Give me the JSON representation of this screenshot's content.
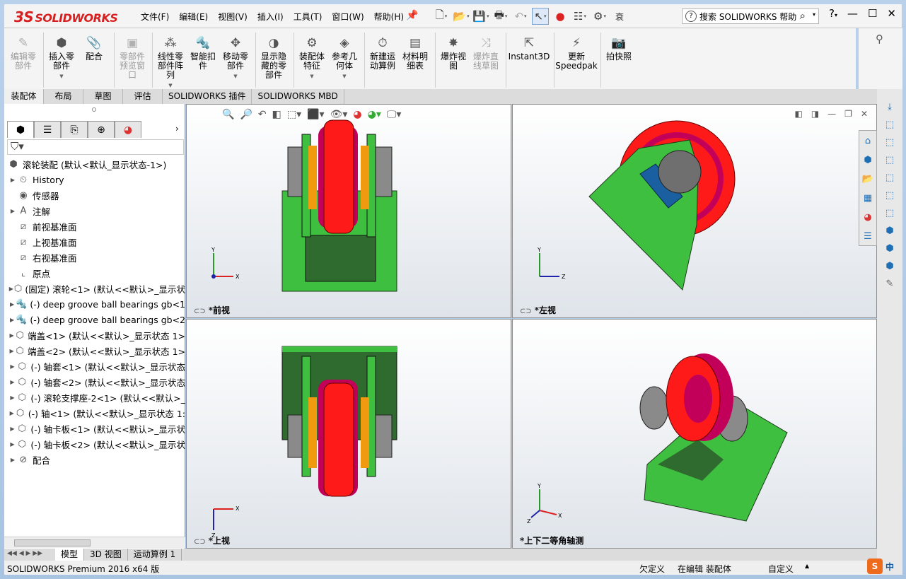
{
  "app": {
    "logo": "SOLIDWORKS",
    "logo_mark": "3S",
    "status_product": "SOLIDWORKS Premium 2016 x64 版"
  },
  "menu": [
    "文件(F)",
    "编辑(E)",
    "视图(V)",
    "插入(I)",
    "工具(T)",
    "窗口(W)",
    "帮助(H)"
  ],
  "quick_more": "衰",
  "search": {
    "placeholder": "搜索 SOLIDWORKS 帮助"
  },
  "ribbon": [
    {
      "label": "编辑零\n部件",
      "enabled": false,
      "icon": "edit-component-icon"
    },
    {
      "label": "插入零\n部件",
      "enabled": true,
      "icon": "insert-components-icon",
      "dropdown": true
    },
    {
      "label": "配合",
      "enabled": true,
      "icon": "mate-icon"
    },
    {
      "label": "零部件\n预览窗\n口",
      "enabled": false,
      "icon": "component-preview-icon"
    },
    {
      "label": "线性零\n部件阵\n列",
      "enabled": true,
      "icon": "linear-pattern-icon",
      "dropdown": true
    },
    {
      "label": "智能扣\n件",
      "enabled": true,
      "icon": "smart-fasteners-icon"
    },
    {
      "label": "移动零\n部件",
      "enabled": true,
      "icon": "move-component-icon",
      "dropdown": true
    },
    {
      "label": "显示隐\n藏的零\n部件",
      "enabled": true,
      "icon": "show-hidden-icon"
    },
    {
      "label": "装配体\n特征",
      "enabled": true,
      "icon": "assembly-features-icon",
      "dropdown": true
    },
    {
      "label": "参考几\n何体",
      "enabled": true,
      "icon": "reference-geometry-icon",
      "dropdown": true
    },
    {
      "label": "新建运\n动算例",
      "enabled": true,
      "icon": "new-motion-study-icon"
    },
    {
      "label": "材料明\n细表",
      "enabled": true,
      "icon": "bom-icon"
    },
    {
      "label": "爆炸视\n图",
      "enabled": true,
      "icon": "exploded-view-icon"
    },
    {
      "label": "爆炸直\n线草图",
      "enabled": false,
      "icon": "explode-line-sketch-icon"
    },
    {
      "label": "Instant3D",
      "enabled": true,
      "icon": "instant3d-icon"
    },
    {
      "label": "更新\nSpeedpak",
      "enabled": true,
      "icon": "speedpak-icon"
    },
    {
      "label": "拍快照",
      "enabled": true,
      "icon": "snapshot-icon"
    }
  ],
  "command_tabs": [
    "装配体",
    "布局",
    "草图",
    "评估",
    "SOLIDWORKS 插件",
    "SOLIDWORKS MBD"
  ],
  "tree": [
    {
      "label": "滚轮装配  (默认<默认_显示状态-1>)",
      "expand": "",
      "indent": 0,
      "icon": "assembly-icon"
    },
    {
      "label": "History",
      "expand": "▶",
      "indent": 1,
      "icon": "history-icon"
    },
    {
      "label": "传感器",
      "expand": "",
      "indent": 1,
      "icon": "sensor-icon"
    },
    {
      "label": "注解",
      "expand": "▶",
      "indent": 1,
      "icon": "annotation-icon"
    },
    {
      "label": "前视基准面",
      "expand": "",
      "indent": 1,
      "icon": "plane-icon"
    },
    {
      "label": "上视基准面",
      "expand": "",
      "indent": 1,
      "icon": "plane-icon"
    },
    {
      "label": "右视基准面",
      "expand": "",
      "indent": 1,
      "icon": "plane-icon"
    },
    {
      "label": "原点",
      "expand": "",
      "indent": 1,
      "icon": "origin-icon"
    },
    {
      "label": "(固定) 滚轮<1> (默认<<默认>_显示状",
      "expand": "▶",
      "indent": 1,
      "icon": "part-icon"
    },
    {
      "label": "(-) deep groove ball bearings gb<1",
      "expand": "▶",
      "indent": 1,
      "icon": "bearing-icon"
    },
    {
      "label": "(-) deep groove ball bearings gb<2",
      "expand": "▶",
      "indent": 1,
      "icon": "bearing-icon"
    },
    {
      "label": "端盖<1> (默认<<默认>_显示状态 1>",
      "expand": "▶",
      "indent": 1,
      "icon": "part-icon"
    },
    {
      "label": "端盖<2> (默认<<默认>_显示状态 1>",
      "expand": "▶",
      "indent": 1,
      "icon": "part-icon"
    },
    {
      "label": "(-) 轴套<1> (默认<<默认>_显示状态",
      "expand": "▶",
      "indent": 1,
      "icon": "part-icon"
    },
    {
      "label": "(-) 轴套<2> (默认<<默认>_显示状态",
      "expand": "▶",
      "indent": 1,
      "icon": "part-icon"
    },
    {
      "label": "(-) 滚轮支撑座-2<1> (默认<<默认>_",
      "expand": "▶",
      "indent": 1,
      "icon": "part-icon"
    },
    {
      "label": "(-) 轴<1> (默认<<默认>_显示状态 1:",
      "expand": "▶",
      "indent": 1,
      "icon": "part-icon"
    },
    {
      "label": "(-) 轴卡板<1> (默认<<默认>_显示状",
      "expand": "▶",
      "indent": 1,
      "icon": "part-icon"
    },
    {
      "label": "(-) 轴卡板<2> (默认<<默认>_显示状",
      "expand": "▶",
      "indent": 1,
      "icon": "part-icon"
    },
    {
      "label": "配合",
      "expand": "▶",
      "indent": 1,
      "icon": "mates-folder-icon"
    }
  ],
  "viewports": {
    "front": "*前视",
    "left": "*左视",
    "top": "*上视",
    "iso": "*上下二等角轴测"
  },
  "axes": {
    "x": "X",
    "y": "Y",
    "z": "Z"
  },
  "model_tabs": [
    "模型",
    "3D 视图",
    "运动算例 1"
  ],
  "status": {
    "underdefined": "欠定义",
    "editing": "在编辑 装配体",
    "custom": "自定义"
  },
  "ime": {
    "brand": "S",
    "lang": "中"
  },
  "colors": {
    "wheel_red": "#ff1a1a",
    "wheel_rim": "#c2005a",
    "support_green": "#3fbf3f",
    "support_dark": "#2f6a2f",
    "shaft_gray": "#8a8a8a",
    "bearing_orange": "#f09a10",
    "plate_blue": "#1a5fa0"
  }
}
